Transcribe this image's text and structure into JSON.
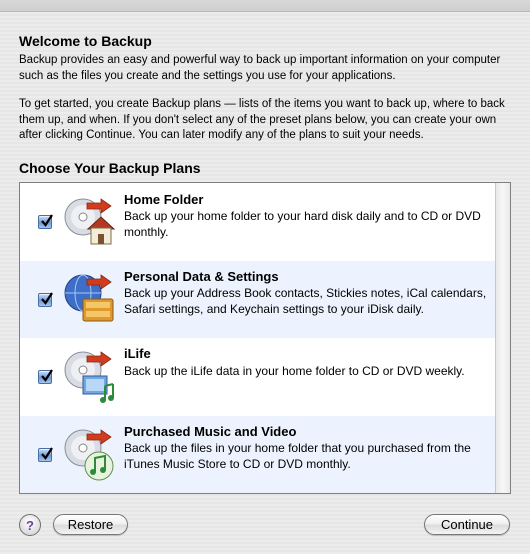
{
  "welcome": {
    "title": "Welcome to Backup",
    "paragraph1": "Backup provides an easy and powerful way to back up important information on your computer such as the files you create and the settings you use for your applications.",
    "paragraph2": "To get started, you create Backup plans — lists of the items you want to back up, where to back them up, and when. If you don't select any of the preset plans below, you can create your own after clicking Continue. You can later modify any of the plans to suit your needs."
  },
  "plans_section": {
    "title": "Choose Your Backup Plans",
    "plans": [
      {
        "title": "Home Folder",
        "description": "Back up your home folder to your hard disk daily and to CD or DVD monthly.",
        "checked": true,
        "icon": "home-folder-icon"
      },
      {
        "title": "Personal Data & Settings",
        "description": "Back up your Address Book contacts, Stickies notes, iCal calendars, Safari settings, and Keychain settings to your iDisk daily.",
        "checked": true,
        "icon": "personal-data-icon"
      },
      {
        "title": "iLife",
        "description": "Back up the iLife data in your home folder to CD or DVD weekly.",
        "checked": true,
        "icon": "ilife-icon"
      },
      {
        "title": "Purchased Music and Video",
        "description": "Back up the files in your home folder that you purchased from the iTunes Music Store to CD or DVD monthly.",
        "checked": true,
        "icon": "purchased-music-icon"
      }
    ]
  },
  "buttons": {
    "help": "?",
    "restore": "Restore",
    "continue": "Continue"
  },
  "colors": {
    "row_alt_background": "#edf3fe",
    "checkbox_blue": "#6f9ad7",
    "backup_arrow_red": "#d23c1e"
  }
}
